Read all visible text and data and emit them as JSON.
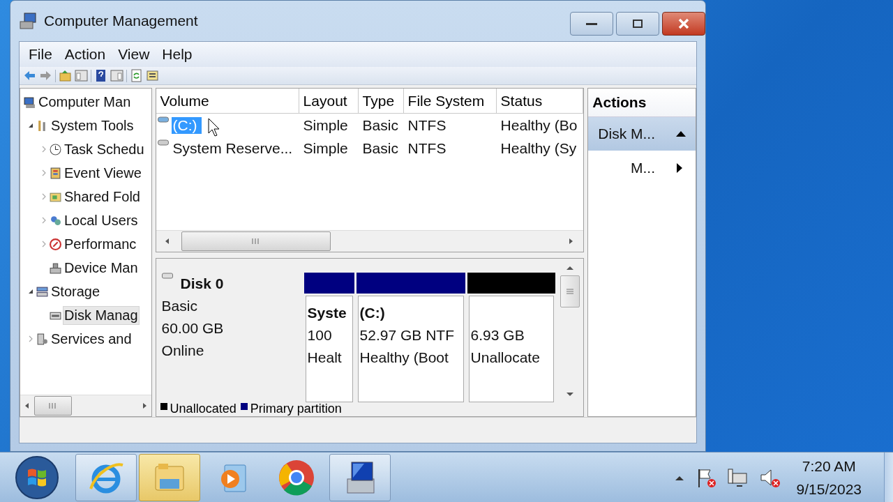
{
  "window": {
    "title": "Computer Management"
  },
  "menu": [
    "File",
    "Action",
    "View",
    "Help"
  ],
  "tree": [
    {
      "label": "Computer Man",
      "selected": false,
      "children": [
        {
          "label": "System Tools",
          "selected": false,
          "expanded": true,
          "children": [
            {
              "label": "Task Schedu",
              "selected": false,
              "expanded": false
            },
            {
              "label": "Event Viewe",
              "selected": false,
              "expanded": false
            },
            {
              "label": "Shared Fold",
              "selected": false,
              "expanded": false
            },
            {
              "label": "Local Users",
              "selected": false,
              "expanded": false
            },
            {
              "label": "Performanc",
              "selected": false,
              "expanded": false
            },
            {
              "label": "Device Man",
              "selected": false
            }
          ]
        },
        {
          "label": "Storage",
          "selected": false,
          "expanded": true,
          "children": [
            {
              "label": "Disk Manag",
              "selected": true
            }
          ]
        },
        {
          "label": "Services and",
          "selected": false,
          "expanded": false
        }
      ]
    }
  ],
  "volumes": {
    "columns": [
      "Volume",
      "Layout",
      "Type",
      "File System",
      "Status"
    ],
    "rows": [
      {
        "selected": true,
        "cells": [
          "(C:)",
          "Simple",
          "Basic",
          "NTFS",
          "Healthy (Bo"
        ]
      },
      {
        "selected": false,
        "cells": [
          "System Reserve...",
          "Simple",
          "Basic",
          "NTFS",
          "Healthy (Sy"
        ]
      }
    ]
  },
  "disk": {
    "name": "Disk 0",
    "type": "Basic",
    "size": "60.00 GB",
    "status": "Online",
    "partitions": [
      {
        "kind": "primary",
        "name": "Syste",
        "lines": [
          "100",
          "Healt"
        ]
      },
      {
        "kind": "primary",
        "name": "(C:)",
        "lines": [
          "52.97 GB NTF",
          "Healthy (Boot"
        ]
      },
      {
        "kind": "unallocated",
        "lines": [
          "6.93 GB",
          "Unallocate"
        ]
      }
    ],
    "legend": [
      {
        "kind": "unallocated",
        "label": "Unallocated"
      },
      {
        "kind": "primary",
        "label": "Primary partition"
      }
    ]
  },
  "actions": {
    "title": "Actions",
    "items": [
      {
        "kind": "header",
        "label": "Disk M...",
        "expanded": true
      },
      {
        "kind": "submenu",
        "label": "M..."
      }
    ]
  },
  "taskbar": {
    "apps": [
      {
        "open": true,
        "highlighted": false
      },
      {
        "open": true,
        "highlighted": true
      },
      {
        "open": false,
        "highlighted": false
      },
      {
        "open": false,
        "highlighted": false
      },
      {
        "open": true,
        "highlighted": false
      }
    ],
    "time": "7:20 AM",
    "date": "9/15/2023"
  }
}
